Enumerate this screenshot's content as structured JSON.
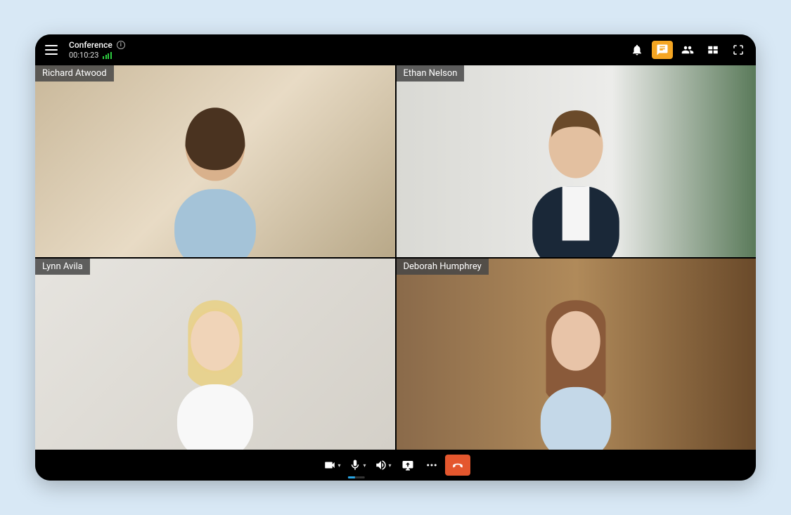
{
  "header": {
    "title": "Conference",
    "timer": "00:10:23"
  },
  "participants": [
    {
      "name": "Richard Atwood"
    },
    {
      "name": "Ethan Nelson"
    },
    {
      "name": "Lynn Avila"
    },
    {
      "name": "Deborah Humphrey"
    }
  ],
  "colors": {
    "accent": "#f5a623",
    "hangup": "#e4572e",
    "signal": "#2ecc40",
    "micLevel": "#29a6e5"
  }
}
